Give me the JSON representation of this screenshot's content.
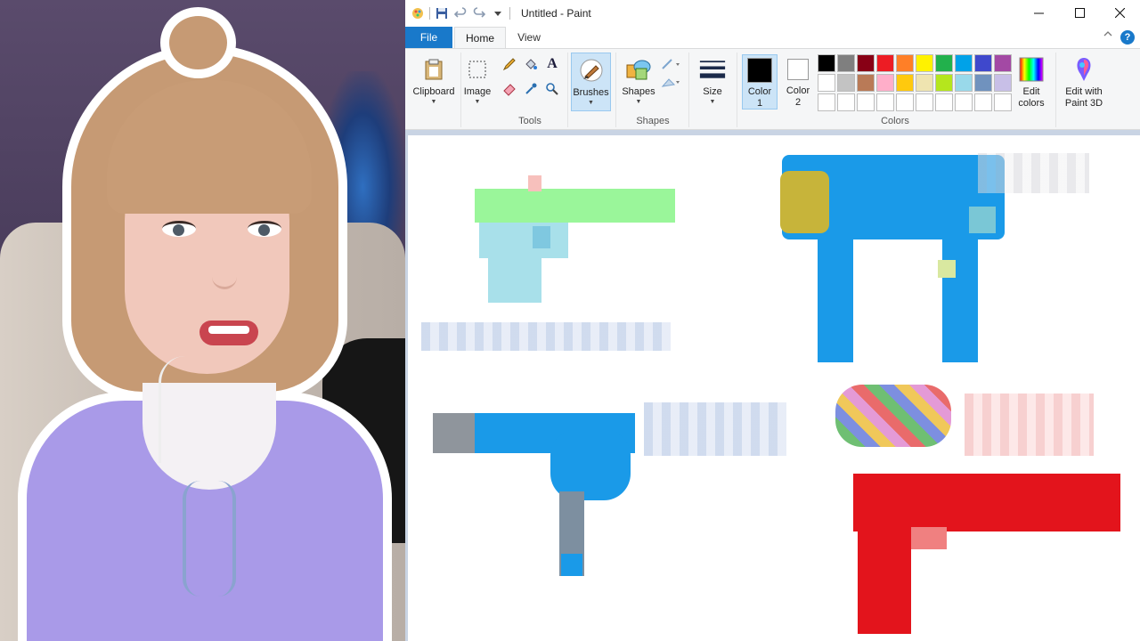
{
  "window": {
    "title": "Untitled - Paint"
  },
  "tabs": [
    {
      "label": "File"
    },
    {
      "label": "Home"
    },
    {
      "label": "View"
    }
  ],
  "ribbon": {
    "clipboard": "Clipboard",
    "image": "Image",
    "tools_group": "Tools",
    "brushes": "Brushes",
    "shapes": "Shapes",
    "shapes_group": "Shapes",
    "size": "Size",
    "color1_line1": "Color",
    "color1_line2": "1",
    "color2_line1": "Color",
    "color2_line2": "2",
    "colors_group": "Colors",
    "edit_colors_line1": "Edit",
    "edit_colors_line2": "colors",
    "paint3d_line1": "Edit with",
    "paint3d_line2": "Paint 3D",
    "help": "?"
  },
  "colors": {
    "color1": "#000000",
    "color2": "#ffffff",
    "palette_row1": [
      "#000000",
      "#7f7f7f",
      "#880015",
      "#ed1c24",
      "#ff7f27",
      "#fff200",
      "#22b14c",
      "#00a2e8",
      "#3f48cc",
      "#a349a4"
    ],
    "palette_row2": [
      "#ffffff",
      "#c3c3c3",
      "#b97a57",
      "#ffaec9",
      "#ffc90e",
      "#efe4b0",
      "#b5e61d",
      "#99d9ea",
      "#7092be",
      "#c8bfe7"
    ],
    "palette_row3_blank": 10
  },
  "icons": {
    "app": "paint-app-icon",
    "save": "save-icon",
    "undo": "undo-icon",
    "redo": "redo-icon",
    "customize": "chevron-down-icon",
    "minimize": "minimize-icon",
    "maximize": "maximize-icon",
    "close": "close-icon"
  }
}
